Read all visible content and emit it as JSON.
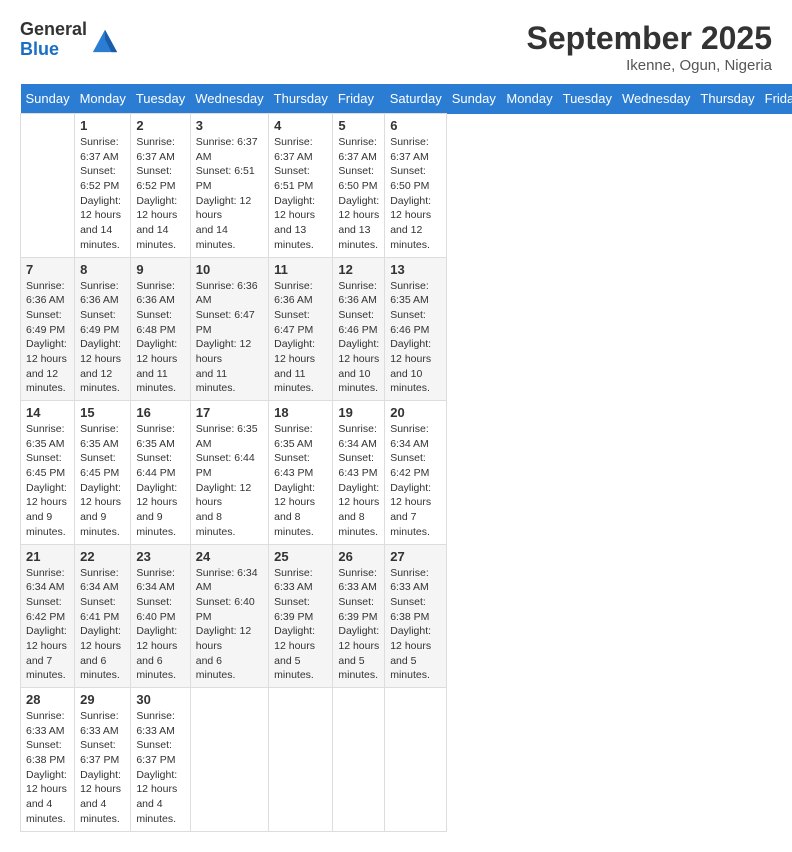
{
  "header": {
    "logo_general": "General",
    "logo_blue": "Blue",
    "month_title": "September 2025",
    "location": "Ikenne, Ogun, Nigeria"
  },
  "days_of_week": [
    "Sunday",
    "Monday",
    "Tuesday",
    "Wednesday",
    "Thursday",
    "Friday",
    "Saturday"
  ],
  "weeks": [
    [
      {
        "day": "",
        "info": ""
      },
      {
        "day": "1",
        "info": "Sunrise: 6:37 AM\nSunset: 6:52 PM\nDaylight: 12 hours\nand 14 minutes."
      },
      {
        "day": "2",
        "info": "Sunrise: 6:37 AM\nSunset: 6:52 PM\nDaylight: 12 hours\nand 14 minutes."
      },
      {
        "day": "3",
        "info": "Sunrise: 6:37 AM\nSunset: 6:51 PM\nDaylight: 12 hours\nand 14 minutes."
      },
      {
        "day": "4",
        "info": "Sunrise: 6:37 AM\nSunset: 6:51 PM\nDaylight: 12 hours\nand 13 minutes."
      },
      {
        "day": "5",
        "info": "Sunrise: 6:37 AM\nSunset: 6:50 PM\nDaylight: 12 hours\nand 13 minutes."
      },
      {
        "day": "6",
        "info": "Sunrise: 6:37 AM\nSunset: 6:50 PM\nDaylight: 12 hours\nand 12 minutes."
      }
    ],
    [
      {
        "day": "7",
        "info": "Sunrise: 6:36 AM\nSunset: 6:49 PM\nDaylight: 12 hours\nand 12 minutes."
      },
      {
        "day": "8",
        "info": "Sunrise: 6:36 AM\nSunset: 6:49 PM\nDaylight: 12 hours\nand 12 minutes."
      },
      {
        "day": "9",
        "info": "Sunrise: 6:36 AM\nSunset: 6:48 PM\nDaylight: 12 hours\nand 11 minutes."
      },
      {
        "day": "10",
        "info": "Sunrise: 6:36 AM\nSunset: 6:47 PM\nDaylight: 12 hours\nand 11 minutes."
      },
      {
        "day": "11",
        "info": "Sunrise: 6:36 AM\nSunset: 6:47 PM\nDaylight: 12 hours\nand 11 minutes."
      },
      {
        "day": "12",
        "info": "Sunrise: 6:36 AM\nSunset: 6:46 PM\nDaylight: 12 hours\nand 10 minutes."
      },
      {
        "day": "13",
        "info": "Sunrise: 6:35 AM\nSunset: 6:46 PM\nDaylight: 12 hours\nand 10 minutes."
      }
    ],
    [
      {
        "day": "14",
        "info": "Sunrise: 6:35 AM\nSunset: 6:45 PM\nDaylight: 12 hours\nand 9 minutes."
      },
      {
        "day": "15",
        "info": "Sunrise: 6:35 AM\nSunset: 6:45 PM\nDaylight: 12 hours\nand 9 minutes."
      },
      {
        "day": "16",
        "info": "Sunrise: 6:35 AM\nSunset: 6:44 PM\nDaylight: 12 hours\nand 9 minutes."
      },
      {
        "day": "17",
        "info": "Sunrise: 6:35 AM\nSunset: 6:44 PM\nDaylight: 12 hours\nand 8 minutes."
      },
      {
        "day": "18",
        "info": "Sunrise: 6:35 AM\nSunset: 6:43 PM\nDaylight: 12 hours\nand 8 minutes."
      },
      {
        "day": "19",
        "info": "Sunrise: 6:34 AM\nSunset: 6:43 PM\nDaylight: 12 hours\nand 8 minutes."
      },
      {
        "day": "20",
        "info": "Sunrise: 6:34 AM\nSunset: 6:42 PM\nDaylight: 12 hours\nand 7 minutes."
      }
    ],
    [
      {
        "day": "21",
        "info": "Sunrise: 6:34 AM\nSunset: 6:42 PM\nDaylight: 12 hours\nand 7 minutes."
      },
      {
        "day": "22",
        "info": "Sunrise: 6:34 AM\nSunset: 6:41 PM\nDaylight: 12 hours\nand 6 minutes."
      },
      {
        "day": "23",
        "info": "Sunrise: 6:34 AM\nSunset: 6:40 PM\nDaylight: 12 hours\nand 6 minutes."
      },
      {
        "day": "24",
        "info": "Sunrise: 6:34 AM\nSunset: 6:40 PM\nDaylight: 12 hours\nand 6 minutes."
      },
      {
        "day": "25",
        "info": "Sunrise: 6:33 AM\nSunset: 6:39 PM\nDaylight: 12 hours\nand 5 minutes."
      },
      {
        "day": "26",
        "info": "Sunrise: 6:33 AM\nSunset: 6:39 PM\nDaylight: 12 hours\nand 5 minutes."
      },
      {
        "day": "27",
        "info": "Sunrise: 6:33 AM\nSunset: 6:38 PM\nDaylight: 12 hours\nand 5 minutes."
      }
    ],
    [
      {
        "day": "28",
        "info": "Sunrise: 6:33 AM\nSunset: 6:38 PM\nDaylight: 12 hours\nand 4 minutes."
      },
      {
        "day": "29",
        "info": "Sunrise: 6:33 AM\nSunset: 6:37 PM\nDaylight: 12 hours\nand 4 minutes."
      },
      {
        "day": "30",
        "info": "Sunrise: 6:33 AM\nSunset: 6:37 PM\nDaylight: 12 hours\nand 4 minutes."
      },
      {
        "day": "",
        "info": ""
      },
      {
        "day": "",
        "info": ""
      },
      {
        "day": "",
        "info": ""
      },
      {
        "day": "",
        "info": ""
      }
    ]
  ]
}
